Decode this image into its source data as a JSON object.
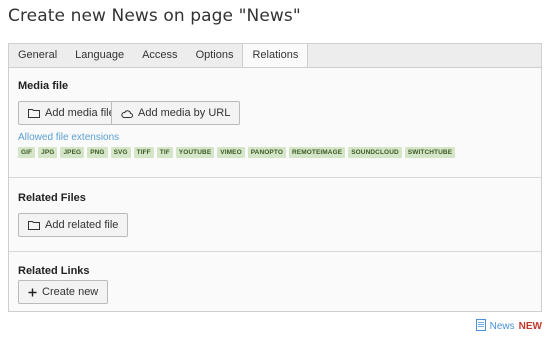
{
  "page": {
    "title": "Create new News on page \"News\""
  },
  "tabs": [
    {
      "label": "General"
    },
    {
      "label": "Language"
    },
    {
      "label": "Access"
    },
    {
      "label": "Options"
    },
    {
      "label": "Relations",
      "active": true
    }
  ],
  "media": {
    "title": "Media file",
    "add_file_label": "Add media file",
    "add_url_label": "Add media by URL",
    "allowed_label": "Allowed file extensions",
    "extensions": [
      "GIF",
      "JPG",
      "JPEG",
      "PNG",
      "SVG",
      "TIFF",
      "TIF",
      "YOUTUBE",
      "VIMEO",
      "PANOPTO",
      "REMOTEIMAGE",
      "SOUNDCLOUD",
      "SWITCHTUBE"
    ]
  },
  "related_files": {
    "title": "Related Files",
    "add_label": "Add related file"
  },
  "related_links": {
    "title": "Related Links",
    "create_label": "Create new"
  },
  "footer": {
    "record_type": "News",
    "state": "NEW",
    "icon": "document-icon"
  },
  "colors": {
    "link": "#5a9fd4",
    "badge_bg": "#d5e6c8",
    "new_state": "#c0392b"
  }
}
